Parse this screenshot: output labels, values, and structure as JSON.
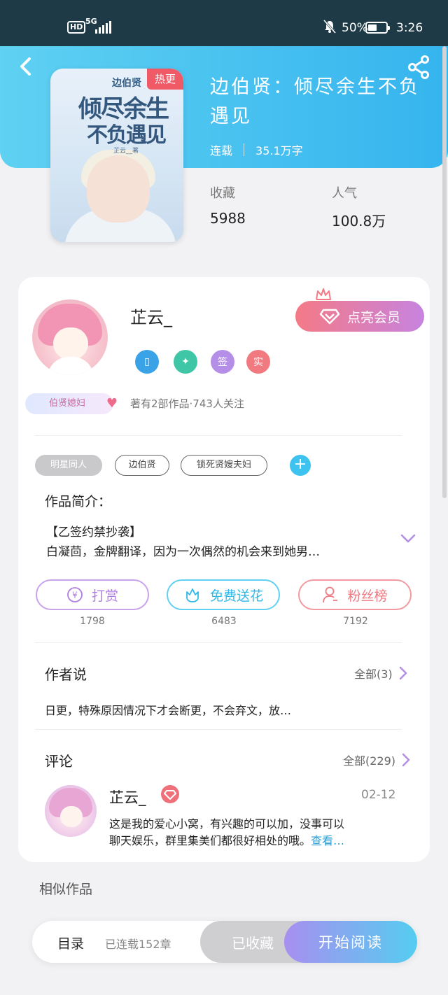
{
  "status_bar": {
    "network": "HD",
    "signal": "5G",
    "battery_pct": "50%",
    "time": "3:26"
  },
  "book": {
    "title": "边伯贤：倾尽余生不负遇见",
    "status": "连载",
    "word_count": "35.1万字",
    "stats": [
      {
        "label": "收藏",
        "value": "5988"
      },
      {
        "label": "人气",
        "value": "100.8万"
      }
    ],
    "cover": {
      "title_small": "边伯贤",
      "title_line1": "倾尽余生",
      "title_line2": "不负遇见",
      "badge": "热更",
      "author": "芷云__著"
    }
  },
  "author": {
    "name": "芷云_",
    "vip_button": "点亮会员",
    "fan_badge": "伯贤媳妇",
    "medals": [
      {
        "icon": "phone-medal-icon",
        "label": "▯",
        "color": "#3aa3e8"
      },
      {
        "icon": "handshake-medal-icon",
        "label": "✦",
        "color": "#3fc6a6"
      },
      {
        "icon": "signed-medal-icon",
        "label": "签",
        "color": "#b58ee8"
      },
      {
        "icon": "verified-medal-icon",
        "label": "实",
        "color": "#f07a7f"
      }
    ],
    "works_info": "著有2部作品·743人关注"
  },
  "tags": [
    "明星同人",
    "边伯贤",
    "锁死贤嫂夫妇"
  ],
  "intro": {
    "label": "作品简介：",
    "line1": "【乙签约禁抄袭】",
    "line2": "白凝茴，金牌翻译，因为一次偶然的机会来到她男…"
  },
  "actions": [
    {
      "label": "打赏",
      "count": "1798"
    },
    {
      "label": "免费送花",
      "count": "6483"
    },
    {
      "label": "粉丝榜",
      "count": "7192"
    }
  ],
  "author_says": {
    "title": "作者说",
    "more": "全部(3)",
    "text": "日更，特殊原因情况下才会断更，不会弃文，放…"
  },
  "comments": {
    "title": "评论",
    "more": "全部(229)",
    "item": {
      "name": "芷云_",
      "date": "02-12",
      "line1": "这是我的爱心小窝，有兴趣的可以加，没事可以",
      "line2": "聊天娱乐，群里集美们都很好相处的哦。",
      "more": "查看…"
    }
  },
  "similar_title": "相似作品",
  "bottom_bar": {
    "toc_label": "目录",
    "toc_info": "已连载152章",
    "collect_label": "已收藏",
    "read_label": "开始阅读"
  },
  "colors": {
    "header_blue": "#35b4ee",
    "accent_pink": "#f47a86",
    "accent_purple": "#b58ee8",
    "accent_cyan": "#3ec2ef"
  }
}
